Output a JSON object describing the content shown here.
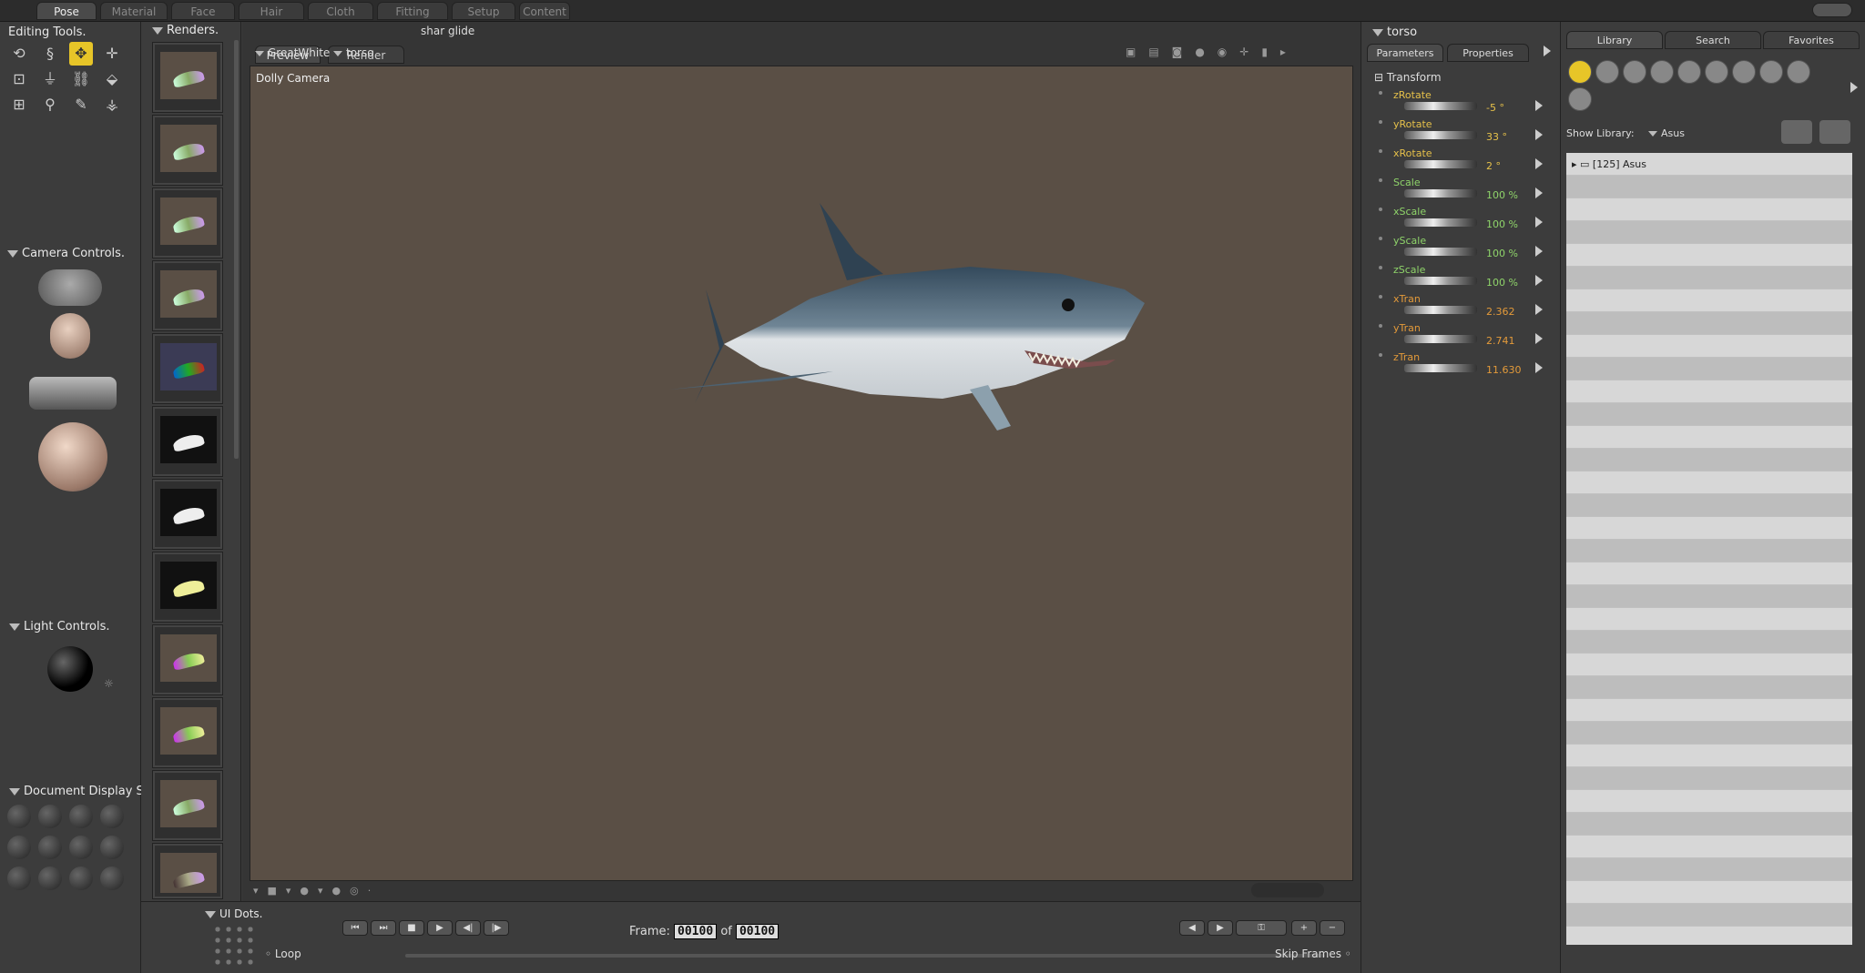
{
  "top_tabs": [
    "Pose",
    "Material",
    "Face",
    "Hair",
    "Cloth",
    "Fitting",
    "Setup",
    "Content"
  ],
  "active_tab": "Pose",
  "left": {
    "editing_tools": "Editing Tools.",
    "camera_controls": "Camera Controls.",
    "light_controls": "Light Controls.",
    "document_display": "Document Display S",
    "ui_dots": "UI Dots."
  },
  "renders": {
    "title": "Renders."
  },
  "viewport": {
    "tabs": [
      "Preview",
      "Render"
    ],
    "scene_name": "shar glide",
    "figure": "GreatWhite",
    "actor": "torso",
    "camera": "Dolly Camera"
  },
  "params": {
    "title": "torso",
    "tabs": [
      "Parameters",
      "Properties"
    ],
    "group": "Transform",
    "items": [
      {
        "name": "zRotate",
        "value": "-5 °",
        "color": "#e6c14a"
      },
      {
        "name": "yRotate",
        "value": "33 °",
        "color": "#e6c14a"
      },
      {
        "name": "xRotate",
        "value": "2 °",
        "color": "#e6c14a"
      },
      {
        "name": "Scale",
        "value": "100 %",
        "color": "#8fd46a"
      },
      {
        "name": "xScale",
        "value": "100 %",
        "color": "#8fd46a"
      },
      {
        "name": "yScale",
        "value": "100 %",
        "color": "#8fd46a"
      },
      {
        "name": "zScale",
        "value": "100 %",
        "color": "#8fd46a"
      },
      {
        "name": "xTran",
        "value": "2.362",
        "color": "#e39a3a"
      },
      {
        "name": "yTran",
        "value": "2.741",
        "color": "#e39a3a"
      },
      {
        "name": "zTran",
        "value": "11.630",
        "color": "#e39a3a"
      }
    ]
  },
  "library": {
    "tabs": [
      "Library",
      "Search",
      "Favorites"
    ],
    "show_library_label": "Show Library:",
    "show_library_value": "Asus",
    "folder": "[125] Asus"
  },
  "timeline": {
    "frame_label": "Frame:",
    "frame": "00100",
    "of_label": "of",
    "total": "00100",
    "loop": "Loop",
    "skip_frames": "Skip Frames"
  }
}
